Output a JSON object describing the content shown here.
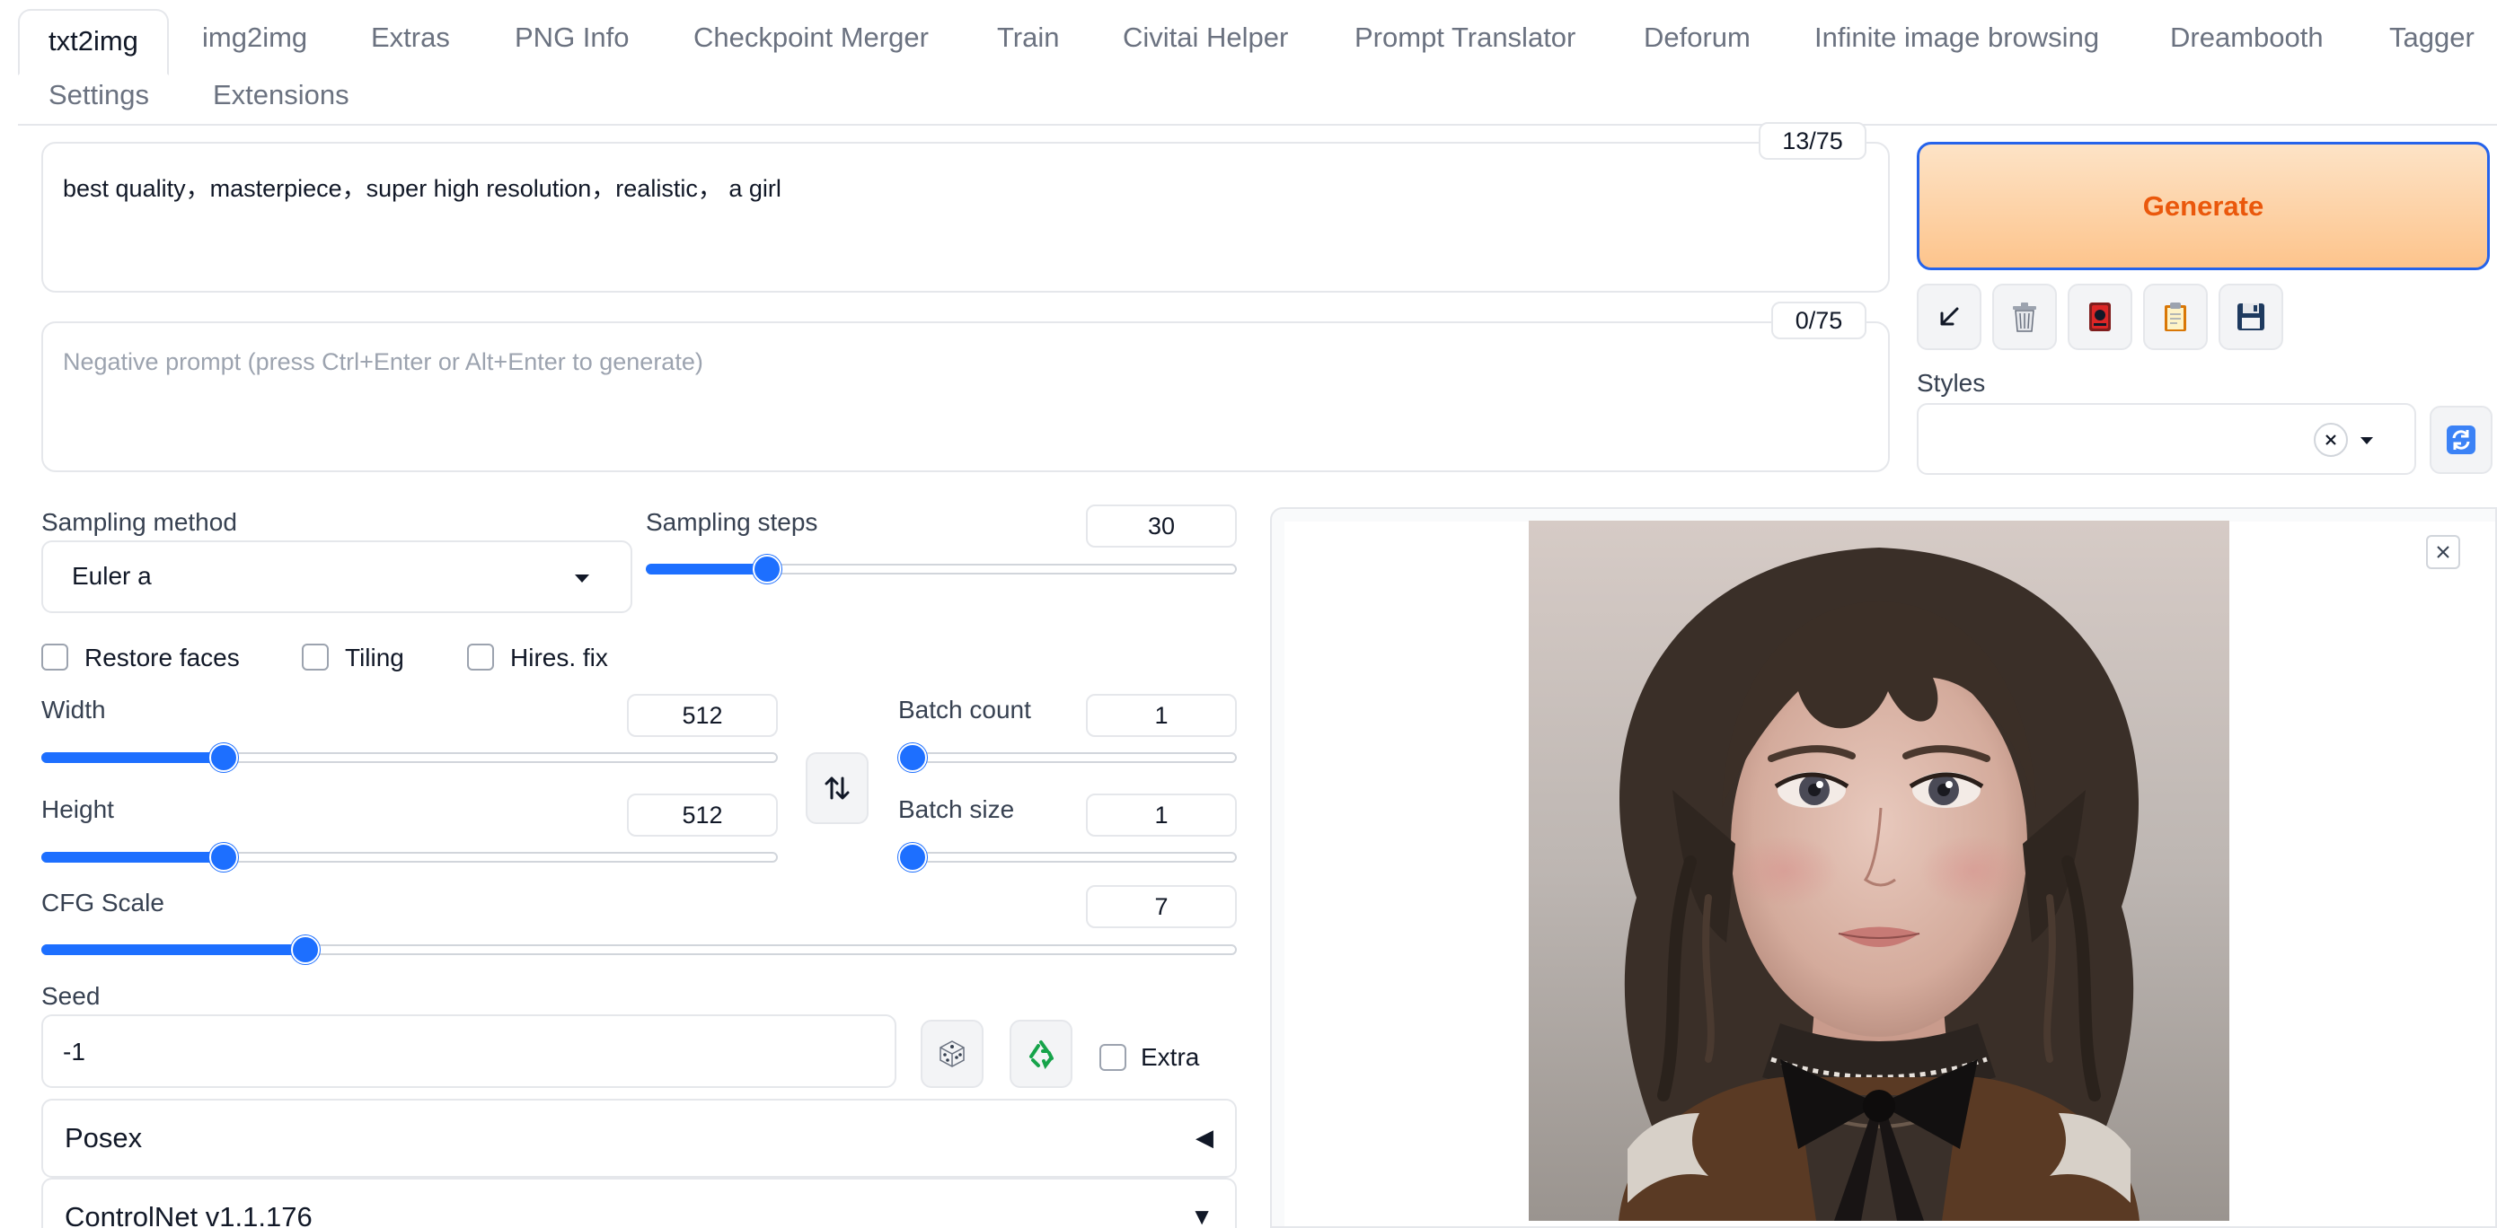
{
  "tabs": [
    {
      "label": "txt2img"
    },
    {
      "label": "img2img"
    },
    {
      "label": "Extras"
    },
    {
      "label": "PNG Info"
    },
    {
      "label": "Checkpoint Merger"
    },
    {
      "label": "Train"
    },
    {
      "label": "Civitai Helper"
    },
    {
      "label": "Prompt Translator"
    },
    {
      "label": "Deforum"
    },
    {
      "label": "Infinite image browsing"
    },
    {
      "label": "Dreambooth"
    },
    {
      "label": "Tagger"
    },
    {
      "label": "Settings"
    },
    {
      "label": "Extensions"
    }
  ],
  "active_tab": "txt2img",
  "prompt": {
    "value": "best quality，masterpiece，super high resolution，realistic， a girl",
    "token_count": "13/75"
  },
  "negative_prompt": {
    "placeholder": "Negative prompt (press Ctrl+Enter or Alt+Enter to generate)",
    "value": "",
    "token_count": "0/75"
  },
  "actions": {
    "generate_label": "Generate",
    "tool_icons": [
      "arrow-down-left-icon",
      "trash-icon",
      "red-card-icon",
      "clipboard-icon",
      "save-icon"
    ]
  },
  "styles": {
    "label": "Styles",
    "value": ""
  },
  "sampling": {
    "method_label": "Sampling method",
    "method_value": "Euler a",
    "steps_label": "Sampling steps",
    "steps_value": "30",
    "steps_fraction": 0.19
  },
  "options": {
    "restore_faces_label": "Restore faces",
    "restore_faces": false,
    "tiling_label": "Tiling",
    "tiling": false,
    "hires_fix_label": "Hires. fix",
    "hires_fix": false
  },
  "dimensions": {
    "width_label": "Width",
    "width_value": "512",
    "width_fraction": 0.237,
    "height_label": "Height",
    "height_value": "512",
    "height_fraction": 0.237
  },
  "batch": {
    "count_label": "Batch count",
    "count_value": "1",
    "count_fraction": 0.0,
    "size_label": "Batch size",
    "size_value": "1",
    "size_fraction": 0.0
  },
  "cfg": {
    "label": "CFG Scale",
    "value": "7",
    "fraction": 0.214
  },
  "seed": {
    "label": "Seed",
    "value": "-1",
    "extra_label": "Extra",
    "extra": false
  },
  "accordions": [
    {
      "title": "Posex",
      "state": "collapsed"
    },
    {
      "title": "ControlNet v1.1.176",
      "state": "expanded"
    }
  ],
  "colors": {
    "accent": "#1d6fff",
    "generate_text": "#ea580c",
    "generate_border": "#2563eb"
  }
}
